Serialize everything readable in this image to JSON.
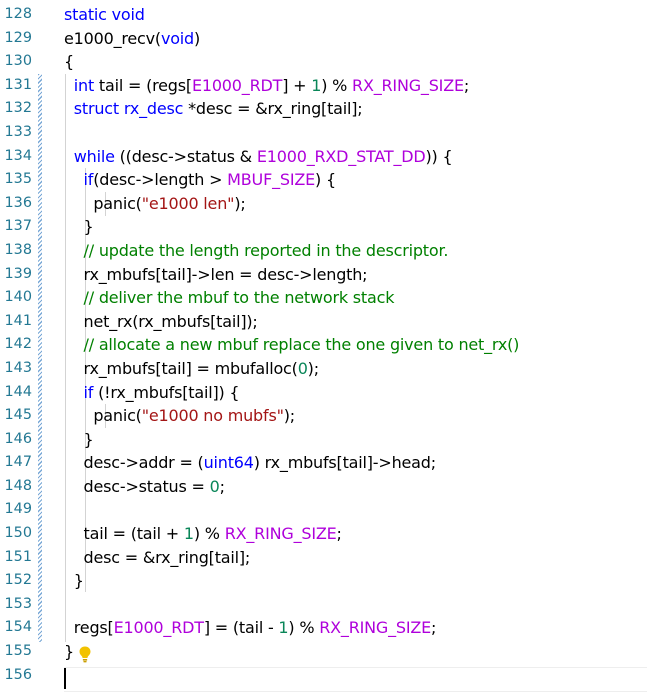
{
  "editor": {
    "line_numbers": [
      "128",
      "129",
      "130",
      "131",
      "132",
      "133",
      "134",
      "135",
      "136",
      "137",
      "138",
      "139",
      "140",
      "141",
      "142",
      "143",
      "144",
      "145",
      "146",
      "147",
      "148",
      "149",
      "150",
      "151",
      "152",
      "153",
      "154",
      "155",
      "156"
    ],
    "lines": [
      [
        {
          "t": "static void",
          "c": "kw"
        }
      ],
      [
        {
          "t": "e1000_recv(",
          "c": ""
        },
        {
          "t": "void",
          "c": "kw"
        },
        {
          "t": ")",
          "c": ""
        }
      ],
      [
        {
          "t": "{",
          "c": ""
        }
      ],
      [
        {
          "t": "  ",
          "c": ""
        },
        {
          "t": "int",
          "c": "kw"
        },
        {
          "t": " tail = (regs[",
          "c": ""
        },
        {
          "t": "E1000_RDT",
          "c": "mac"
        },
        {
          "t": "] + ",
          "c": ""
        },
        {
          "t": "1",
          "c": "num"
        },
        {
          "t": ") % ",
          "c": ""
        },
        {
          "t": "RX_RING_SIZE",
          "c": "mac"
        },
        {
          "t": ";",
          "c": ""
        }
      ],
      [
        {
          "t": "  ",
          "c": ""
        },
        {
          "t": "struct rx_desc",
          "c": "kw"
        },
        {
          "t": " *desc = &rx_ring[tail];",
          "c": ""
        }
      ],
      [],
      [
        {
          "t": "  ",
          "c": ""
        },
        {
          "t": "while",
          "c": "kw"
        },
        {
          "t": " ((desc->status & ",
          "c": ""
        },
        {
          "t": "E1000_RXD_STAT_DD",
          "c": "mac"
        },
        {
          "t": ")) {",
          "c": ""
        }
      ],
      [
        {
          "t": "    ",
          "c": ""
        },
        {
          "t": "if",
          "c": "kw"
        },
        {
          "t": "(desc->length > ",
          "c": ""
        },
        {
          "t": "MBUF_SIZE",
          "c": "mac"
        },
        {
          "t": ") {",
          "c": ""
        }
      ],
      [
        {
          "t": "      panic(",
          "c": ""
        },
        {
          "t": "\"e1000 len\"",
          "c": "str"
        },
        {
          "t": ");",
          "c": ""
        }
      ],
      [
        {
          "t": "    }",
          "c": ""
        }
      ],
      [
        {
          "t": "    ",
          "c": ""
        },
        {
          "t": "// update the length reported in the descriptor.",
          "c": "cmt"
        }
      ],
      [
        {
          "t": "    rx_mbufs[tail]->len = desc->length;",
          "c": ""
        }
      ],
      [
        {
          "t": "    ",
          "c": ""
        },
        {
          "t": "// deliver the mbuf to the network stack",
          "c": "cmt"
        }
      ],
      [
        {
          "t": "    net_rx(rx_mbufs[tail]);",
          "c": ""
        }
      ],
      [
        {
          "t": "    ",
          "c": ""
        },
        {
          "t": "// allocate a new mbuf replace the one given to net_rx()",
          "c": "cmt"
        }
      ],
      [
        {
          "t": "    rx_mbufs[tail] = mbufalloc(",
          "c": ""
        },
        {
          "t": "0",
          "c": "num"
        },
        {
          "t": ");",
          "c": ""
        }
      ],
      [
        {
          "t": "    ",
          "c": ""
        },
        {
          "t": "if",
          "c": "kw"
        },
        {
          "t": " (!rx_mbufs[tail]) {",
          "c": ""
        }
      ],
      [
        {
          "t": "      panic(",
          "c": ""
        },
        {
          "t": "\"e1000 no mubfs\"",
          "c": "str"
        },
        {
          "t": ");",
          "c": ""
        }
      ],
      [
        {
          "t": "    }",
          "c": ""
        }
      ],
      [
        {
          "t": "    desc->addr = (",
          "c": ""
        },
        {
          "t": "uint64",
          "c": "kw"
        },
        {
          "t": ") rx_mbufs[tail]->head;",
          "c": ""
        }
      ],
      [
        {
          "t": "    desc->status = ",
          "c": ""
        },
        {
          "t": "0",
          "c": "num"
        },
        {
          "t": ";",
          "c": ""
        }
      ],
      [],
      [
        {
          "t": "    tail = (tail + ",
          "c": ""
        },
        {
          "t": "1",
          "c": "num"
        },
        {
          "t": ") % ",
          "c": ""
        },
        {
          "t": "RX_RING_SIZE",
          "c": "mac"
        },
        {
          "t": ";",
          "c": ""
        }
      ],
      [
        {
          "t": "    desc = &rx_ring[tail];",
          "c": ""
        }
      ],
      [
        {
          "t": "  }",
          "c": ""
        }
      ],
      [],
      [
        {
          "t": "  regs[",
          "c": ""
        },
        {
          "t": "E1000_RDT",
          "c": "mac"
        },
        {
          "t": "] = (tail - ",
          "c": ""
        },
        {
          "t": "1",
          "c": "num"
        },
        {
          "t": ") % ",
          "c": ""
        },
        {
          "t": "RX_RING_SIZE",
          "c": "mac"
        },
        {
          "t": ";",
          "c": ""
        }
      ],
      [
        {
          "t": "}",
          "c": ""
        }
      ],
      []
    ],
    "icons": {
      "lightbulb": "lightbulb-icon"
    },
    "colors": {
      "keyword": "#0000ff",
      "macro": "#af00db",
      "string": "#a31515",
      "number": "#098658",
      "comment": "#008000",
      "line_number": "#237893",
      "lightbulb": "#f2c200"
    }
  }
}
